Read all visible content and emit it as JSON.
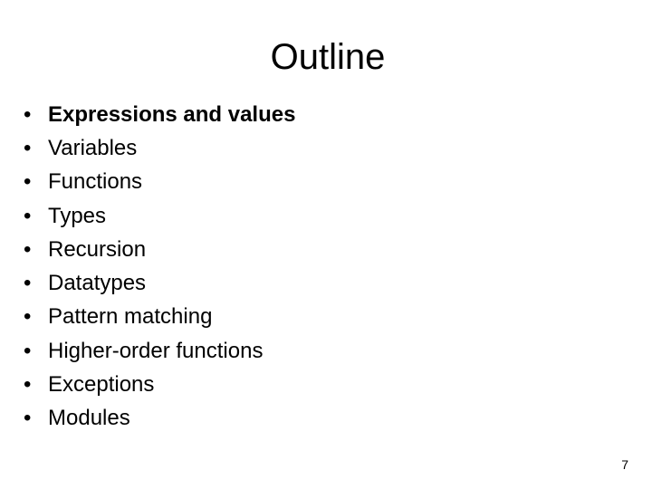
{
  "slide": {
    "title": "Outline",
    "bullet_glyph": "•",
    "items": [
      {
        "label": "Expressions and values",
        "emphasized": true
      },
      {
        "label": "Variables",
        "emphasized": false
      },
      {
        "label": "Functions",
        "emphasized": false
      },
      {
        "label": "Types",
        "emphasized": false
      },
      {
        "label": "Recursion",
        "emphasized": false
      },
      {
        "label": "Datatypes",
        "emphasized": false
      },
      {
        "label": "Pattern matching",
        "emphasized": false
      },
      {
        "label": "Higher-order functions",
        "emphasized": false
      },
      {
        "label": "Exceptions",
        "emphasized": false
      },
      {
        "label": "Modules",
        "emphasized": false
      }
    ],
    "page_number": "7"
  }
}
